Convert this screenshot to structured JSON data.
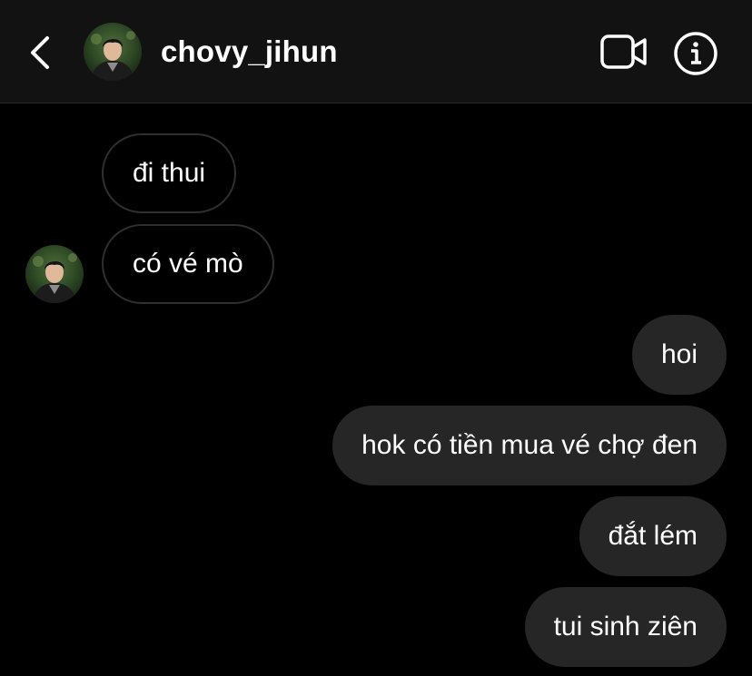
{
  "header": {
    "username": "chovy_jihun",
    "back_icon": "chevron-left-icon",
    "video_icon": "video-camera-icon",
    "info_icon": "info-icon"
  },
  "messages": [
    {
      "direction": "incoming",
      "text": "đi thui"
    },
    {
      "direction": "incoming",
      "text": "có vé mò"
    },
    {
      "direction": "outgoing",
      "text": "hoi"
    },
    {
      "direction": "outgoing",
      "text": "hok có tiền mua vé chợ đen"
    },
    {
      "direction": "outgoing",
      "text": "đắt lém"
    },
    {
      "direction": "outgoing",
      "text": "tui sinh ziên"
    }
  ],
  "colors": {
    "background": "#000000",
    "header_background": "#121212",
    "outgoing_bubble": "#262626",
    "incoming_border": "#2f2f2f",
    "text": "#ffffff"
  }
}
